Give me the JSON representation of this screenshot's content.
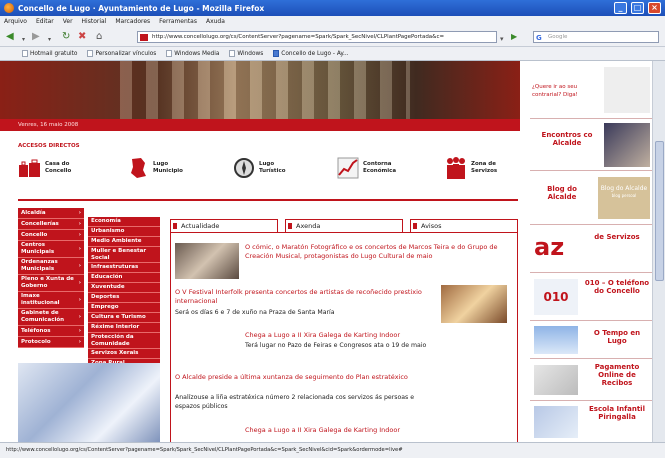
{
  "window": {
    "title": "Concello de Lugo · Ayuntamiento de Lugo - Mozilla Firefox"
  },
  "menu": [
    "Arquivo",
    "Editar",
    "Ver",
    "Historial",
    "Marcadores",
    "Ferramentas",
    "Axuda"
  ],
  "url": "http://www.concellolugo.org/cs/ContentServer?pagename=Spark/Spark_SecNivel/CLPlantPagePortada&c=",
  "search_placeholder": "Google",
  "bookmarks": [
    "Hotmail gratuito",
    "Personalizar vínculos",
    "Windows Media",
    "Windows",
    "Concello de Lugo - Ay..."
  ],
  "header": {
    "date": "Venres, 16 maio 2008"
  },
  "accesos_title": "ACCESOS DIRECTOS",
  "quick_links": [
    "Casa do Concello",
    "Lugo Municipio",
    "Lugo Turístico",
    "Contorna Económica",
    "Zona de Servizos"
  ],
  "left_menu": [
    "Alcaldía",
    "Concellerías",
    "Concello",
    "Centros Municipais",
    "Ordenanzas Municipais",
    "Pleno e Xunta de Goberno",
    "Imaxe institucional",
    "Gabinete de Comunicación",
    "Teléfonos",
    "Protocolo"
  ],
  "left_menu2": [
    "Economía",
    "Urbanismo",
    "Medio Ambiente",
    "Muller e Benestar Social",
    "Infraestruturas",
    "Educación",
    "Xuventude",
    "Deportes",
    "Emprego",
    "Cultura e Turismo",
    "Réxime Interior",
    "Protección da Comunidade",
    "Servizos Xerais",
    "Zona Rural",
    "Transportes"
  ],
  "tabs": [
    "Actualidade",
    "Axenda",
    "Avisos"
  ],
  "news": [
    {
      "title": "O cómic, o Maratón Fotográfico e os concertos de Marcos Teira e do Grupo de Creación Musical, protagonistas do Lugo Cultural de maio",
      "body": ""
    },
    {
      "title": "O V Festival Interfolk presenta concertos de artistas de recoñecido prestixio internacional",
      "body": "Será os días 6 e 7 de xuño na Praza de Santa María"
    },
    {
      "title": "Chega a Lugo a II Xira Galega de Karting Indoor",
      "body": "Terá lugar no Pazo de Feiras e Congresos ata o 19 de maio"
    },
    {
      "title": "O Alcalde preside a última xuntanza de seguimento do Plan estratéxico",
      "body": "Analízouse a liña estratéxica número 2 relacionada cos servizos ás persoas e espazos públicos"
    },
    {
      "title": "Chega a Lugo a II Xira Galega de Karting Indoor",
      "body": ""
    }
  ],
  "sidebar": [
    {
      "label": "¿Quere ir ao seu contrarial? Diga!"
    },
    {
      "label": "Encontros co Alcalde"
    },
    {
      "label": "Blog do Alcalde",
      "img_text": "Blog do Alcalde",
      "img_sub": "blog persoal"
    },
    {
      "label": "de Servizos",
      "img_text": "az"
    },
    {
      "label": "010 – O teléfono do Concello",
      "img_text": "010"
    },
    {
      "label": "O Tempo en Lugo"
    },
    {
      "label": "Pagamento Online de Recibos"
    },
    {
      "label": "Escola Infantil Piringalla"
    }
  ],
  "status_url": "http://www.concellolugo.org/cs/ContentServer?pagename=Spark/Spark_SecNivel/CLPlantPagePortada&c=Spark_SecNivel&cid=Spark&ordermode=live#",
  "colors": {
    "brand": "#c0141c",
    "titlebar": "#1d4fb8"
  }
}
